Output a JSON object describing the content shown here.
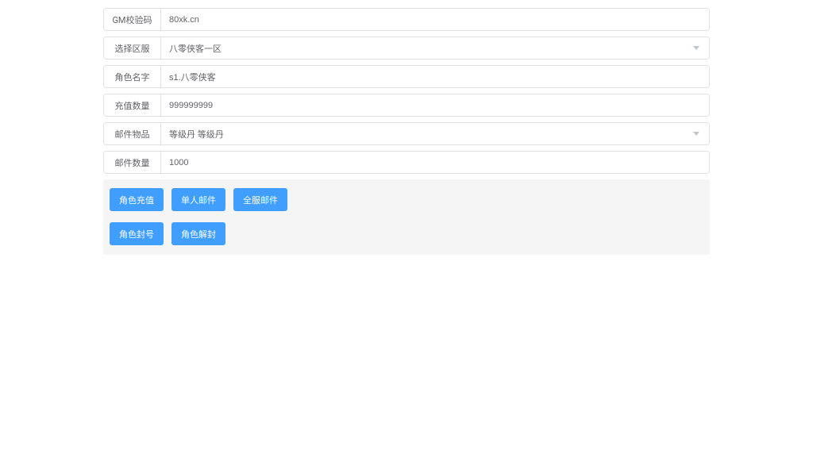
{
  "form": {
    "gm_code": {
      "label": "GM校验码",
      "value": "80xk.cn"
    },
    "server": {
      "label": "选择区服",
      "value": "八零侠客一区"
    },
    "role_name": {
      "label": "角色名字",
      "value": "s1.八零侠客"
    },
    "recharge_amount": {
      "label": "充值数量",
      "value": "999999999"
    },
    "mail_item": {
      "label": "邮件物品",
      "value": "等级丹  等级丹"
    },
    "mail_quantity": {
      "label": "邮件数量",
      "value": "1000"
    }
  },
  "buttons": {
    "row1": {
      "recharge": "角色充值",
      "single_mail": "单人邮件",
      "server_mail": "全服邮件"
    },
    "row2": {
      "ban": "角色封号",
      "unban": "角色解封"
    }
  }
}
